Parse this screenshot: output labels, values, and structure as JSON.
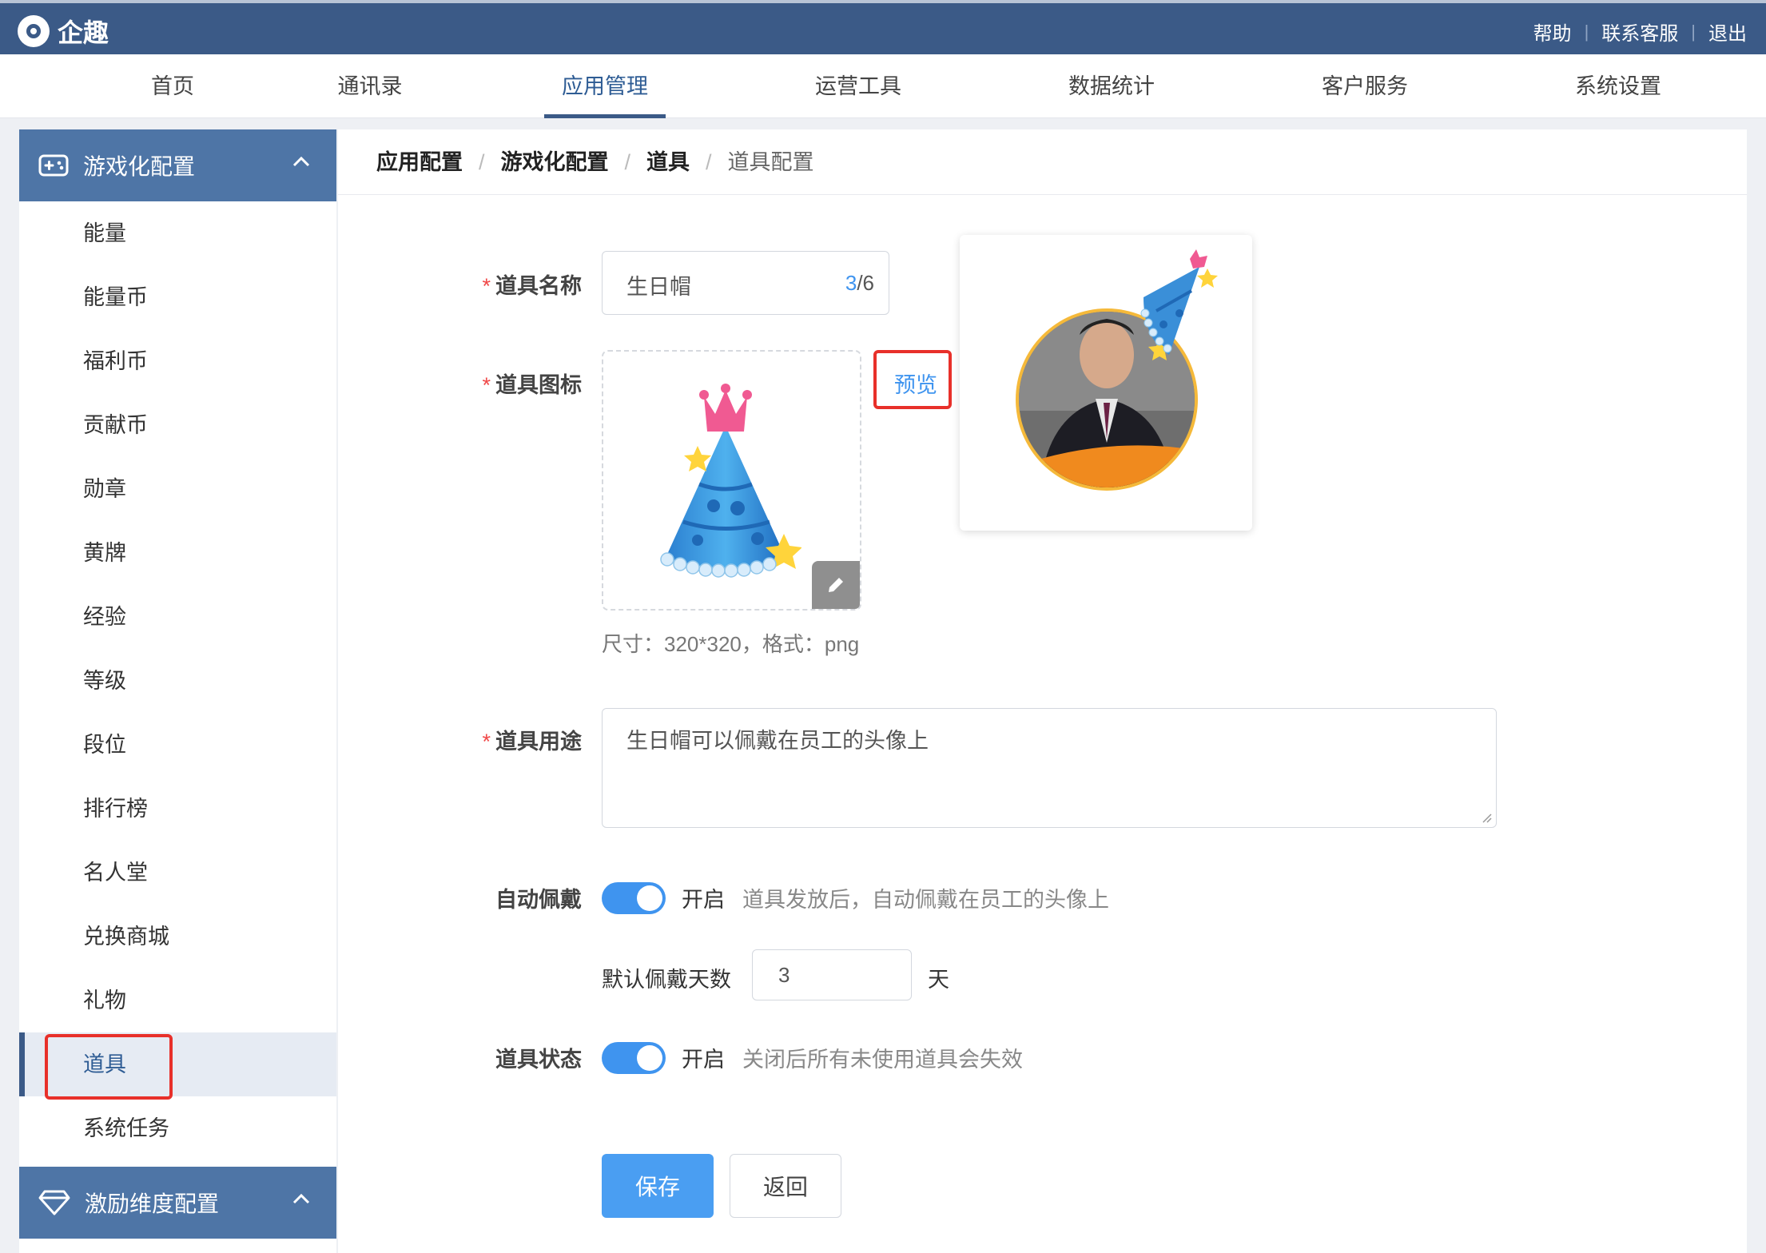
{
  "app": {
    "name": "企趣"
  },
  "top_links": [
    "帮助",
    "联系客服",
    "退出"
  ],
  "nav": {
    "items": [
      "首页",
      "通讯录",
      "应用管理",
      "运营工具",
      "数据统计",
      "客户服务",
      "系统设置"
    ],
    "active": "应用管理"
  },
  "sidebar": {
    "group1": {
      "title": "游戏化配置",
      "icon": "gamepad-icon"
    },
    "items": [
      "能量",
      "能量币",
      "福利币",
      "贡献币",
      "勋章",
      "黄牌",
      "经验",
      "等级",
      "段位",
      "排行榜",
      "名人堂",
      "兑换商城",
      "礼物",
      "道具",
      "系统任务"
    ],
    "active": "道具",
    "group2": {
      "title": "激励维度配置",
      "icon": "diamond-icon"
    }
  },
  "breadcrumb": [
    "应用配置",
    "游戏化配置",
    "道具",
    "道具配置"
  ],
  "form": {
    "name": {
      "label": "道具名称",
      "value": "生日帽",
      "count_current": "3",
      "count_max": "/6"
    },
    "icon": {
      "label": "道具图标",
      "preview_label": "预览",
      "hint": "尺寸：320*320，格式：png"
    },
    "usage": {
      "label": "道具用途",
      "value": "生日帽可以佩戴在员工的头像上"
    },
    "auto_wear": {
      "label": "自动佩戴",
      "state": "开启",
      "desc": "道具发放后，自动佩戴在员工的头像上"
    },
    "default_days": {
      "label": "默认佩戴天数",
      "value": "3",
      "unit": "天"
    },
    "status": {
      "label": "道具状态",
      "state": "开启",
      "desc": "关闭后所有未使用道具会失效"
    },
    "save_label": "保存",
    "back_label": "返回"
  },
  "colors": {
    "header": "#3b5a87",
    "sidebar_group": "#4e75a6",
    "primary": "#4a9ef2",
    "highlight": "#e8302a"
  }
}
